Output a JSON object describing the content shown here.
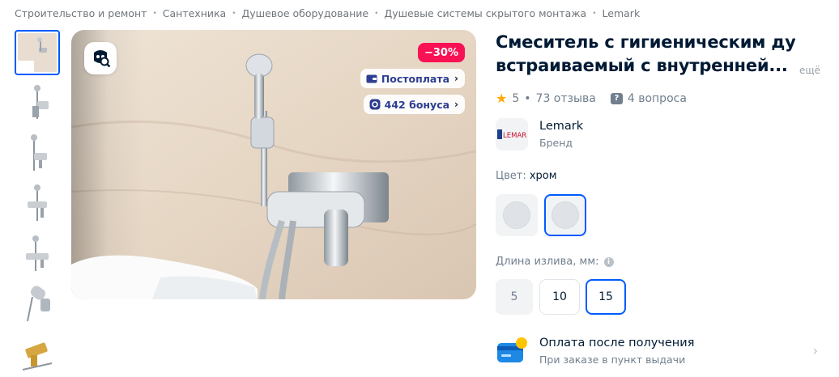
{
  "breadcrumbs": [
    "Строительство и ремонт",
    "Сантехника",
    "Душевое оборудование",
    "Душевые системы скрытого монтажа",
    "Lemark"
  ],
  "gallery": {
    "thumbnails": [
      "thumb-1",
      "thumb-2",
      "thumb-3",
      "thumb-4",
      "thumb-5",
      "thumb-6",
      "thumb-7"
    ],
    "active_index": 0,
    "discount_badge": "−30%",
    "postpay_label": "Постоплата",
    "bonus_label": "442 бонуса",
    "search_icon": "image-search-icon"
  },
  "product": {
    "title_line1": "Смеситель с гигиеническим душем",
    "title_line2": "встраиваемый с внутренней...",
    "more_link": "ещё",
    "rating_value": "5",
    "reviews": "73 отзыва",
    "questions": "4 вопроса",
    "brand_name": "Lemark",
    "brand_caption": "Бренд",
    "brand_logo_text": "LEMARK"
  },
  "options": {
    "color_label": "Цвет:",
    "color_value": "хром",
    "length_label": "Длина излива, мм:",
    "lengths": [
      "5",
      "10",
      "15"
    ],
    "selected_length": "15"
  },
  "payment": {
    "title": "Оплата после получения",
    "subtitle": "При заказе в пункт выдачи"
  },
  "colors": {
    "accent": "#005bff",
    "discount": "#f91155",
    "star": "#ffa800"
  }
}
